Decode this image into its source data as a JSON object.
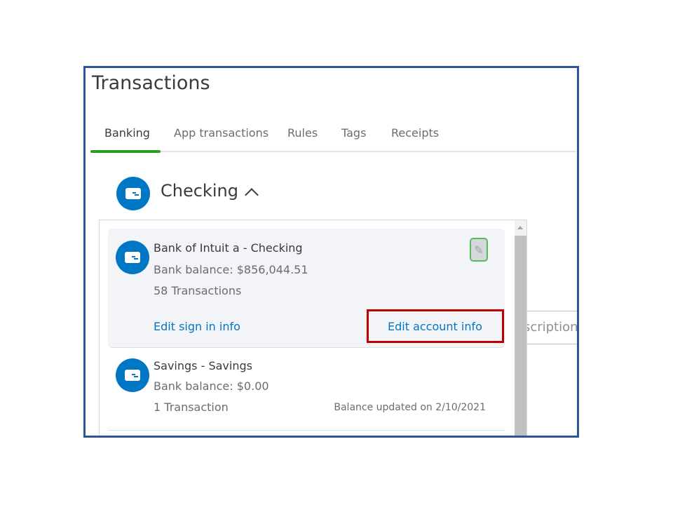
{
  "header": {
    "title": "Transactions"
  },
  "tabs": [
    {
      "label": "Banking",
      "active": true
    },
    {
      "label": "App transactions"
    },
    {
      "label": "Rules"
    },
    {
      "label": "Tags"
    },
    {
      "label": "Receipts"
    }
  ],
  "account_selector": {
    "label": "Checking",
    "icon": "bank-card-icon",
    "chevron": "chevron-up-icon"
  },
  "background_field": {
    "value": "Description"
  },
  "accounts": [
    {
      "name": "Bank of Intuit a - Checking",
      "balance": "Bank balance:  $856,044.51",
      "transactions": "58 Transactions",
      "edit_sign_in": "Edit sign in info",
      "edit_account": "Edit account info",
      "icon": "pencil-icon"
    },
    {
      "name": "Savings - Savings",
      "balance": "Bank balance:  $0.00",
      "transactions": "1 Transaction",
      "updated": "Balance updated on 2/10/2021"
    }
  ],
  "colors": {
    "accent": "#0077c5",
    "active_tab": "#2ca01c",
    "highlight": "#c00000",
    "frame": "#2f5597"
  }
}
